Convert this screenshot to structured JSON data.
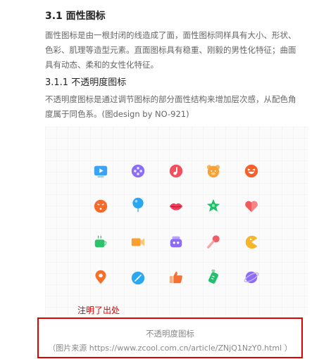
{
  "section": {
    "heading": "3.1 面性图标",
    "paragraph_line1": "面性图标是由一根封闭的线造成了面，面性图标同样具有大小、形状、",
    "paragraph_line2": "色彩、肌理等造型元素。直面图标具有稳重、刚毅的男性化特征；曲面",
    "paragraph_line3": "具有动态、柔和的女性化特征。"
  },
  "subsection": {
    "heading": "3.1.1 不透明度图标",
    "paragraph_line1": "不透明度图标是通过调节图标的部分面性结构来增加层次感，从配色角",
    "paragraph_line2": "度属于同色系。(图design by NO-921)"
  },
  "icons": [
    {
      "name": "video-play-icon",
      "color": "#3aa3f5"
    },
    {
      "name": "film-reel-icon",
      "color": "#8b6cf6"
    },
    {
      "name": "music-note-icon",
      "color": "#f2505e"
    },
    {
      "name": "bear-face-icon",
      "color": "#f6a23a"
    },
    {
      "name": "laughing-face-icon",
      "color": "#f6602a"
    },
    {
      "name": "angry-face-icon",
      "color": "#f66a2a"
    },
    {
      "name": "balloon-icon",
      "color": "#29a6f0"
    },
    {
      "name": "lips-icon",
      "color": "#f23c5c"
    },
    {
      "name": "star-icon",
      "color": "#1fc06a"
    },
    {
      "name": "heart-icon",
      "color": "#f25a5a"
    },
    {
      "name": "tea-cup-icon",
      "color": "#2ec26c"
    },
    {
      "name": "video-camera-icon",
      "color": "#f7a030"
    },
    {
      "name": "robot-icon",
      "color": "#8d6cf5"
    },
    {
      "name": "microphone-icon",
      "color": "#f25d6a"
    },
    {
      "name": "pacman-icon",
      "color": "#f7b32a"
    },
    {
      "name": "location-pin-icon",
      "color": "#f6702a"
    },
    {
      "name": "rugby-ball-icon",
      "color": "#2aa8f0"
    },
    {
      "name": "thumbs-up-icon",
      "color": "#f7702f"
    },
    {
      "name": "baby-bottle-icon",
      "color": "#22bf6c"
    },
    {
      "name": "planet-icon",
      "color": "#8c6cf5"
    }
  ],
  "annotation": "注明了出处",
  "caption": {
    "title": "不透明度图标",
    "source": "（图片来源 https://www.zcool.com.cn/article/ZNjQ1NzY0.html ）"
  }
}
